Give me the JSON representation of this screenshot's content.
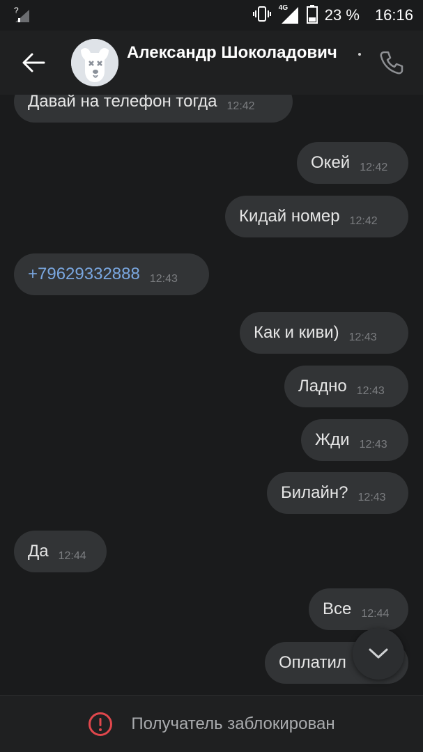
{
  "status_bar": {
    "signal_left_icon": "signal-unknown-icon",
    "network_type": "4G",
    "battery_percent": "23 %",
    "time": "16:16"
  },
  "header": {
    "back_icon": "arrow-left-icon",
    "avatar_icon": "vk-dog-avatar",
    "contact_name": "Александр Шоколадович",
    "call_icon": "phone-icon"
  },
  "messages": [
    {
      "side": "in",
      "text": "Давай на телефон тогда",
      "time": "12:42"
    },
    {
      "side": "out",
      "text": "Окей",
      "time": "12:42"
    },
    {
      "side": "out",
      "text": "Кидай номер",
      "time": "12:42"
    },
    {
      "side": "in",
      "text": "+79629332888",
      "time": "12:43",
      "link": true
    },
    {
      "side": "out",
      "text": "Как и киви)",
      "time": "12:43"
    },
    {
      "side": "out",
      "text": "Ладно",
      "time": "12:43"
    },
    {
      "side": "out",
      "text": "Жди",
      "time": "12:43"
    },
    {
      "side": "out",
      "text": "Билайн?",
      "time": "12:43"
    },
    {
      "side": "in",
      "text": "Да",
      "time": "12:44"
    },
    {
      "side": "out",
      "text": "Все",
      "time": "12:44"
    },
    {
      "side": "out",
      "text": "Оплатил",
      "time": ""
    }
  ],
  "scroll_down_icon": "chevron-down-icon",
  "footer": {
    "icon": "alert-circle-icon",
    "accent_color": "#e0474c",
    "text": "Получатель заблокирован"
  }
}
